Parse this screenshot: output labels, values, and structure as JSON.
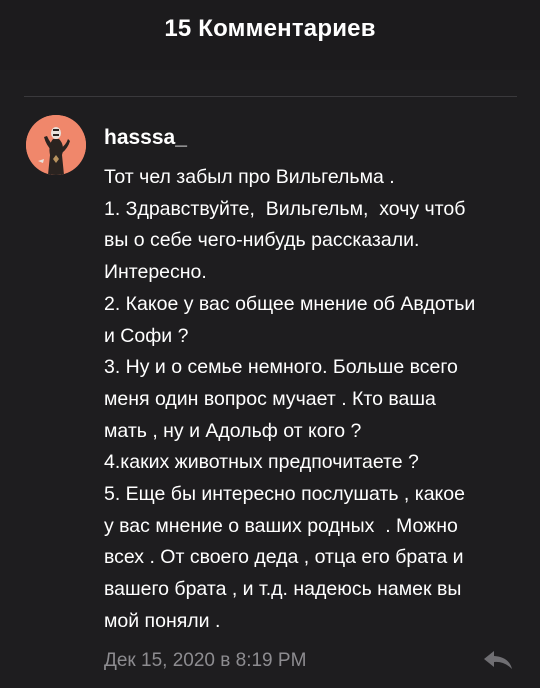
{
  "header": {
    "title": "15 Комментариев"
  },
  "comment": {
    "username": "hasssa_",
    "text": "Тот чел забыл про Вильгельма .\n1. Здравствуйте,  Вильгельм,  хочу чтоб\nвы о себе чего-нибудь рассказали.\nИнтересно.\n2. Какое у вас общее мнение об Авдотьи\nи Софи ?\n3. Ну и о семье немного. Больше всего\nменя один вопрос мучает . Кто ваша\nмать , ну и Адольф от кого ?\n4.каких животных предпочитаете ?\n5. Еще бы интересно послушать , какое\nу вас мнение о ваших родных  . Можно\nвсех . От своего деда , отца его брата и\nвашего брата , и т.д. надеюсь намек вы\nмой поняли .",
    "timestamp": "Дек 15, 2020 в 8:19 PM",
    "avatar_icon": "user-avatar",
    "reply_icon": "reply-arrow-icon"
  },
  "colors": {
    "background": "#1e1d1f",
    "text": "#ffffff",
    "muted": "#8d8c90",
    "avatar_bg": "#f0876b"
  }
}
